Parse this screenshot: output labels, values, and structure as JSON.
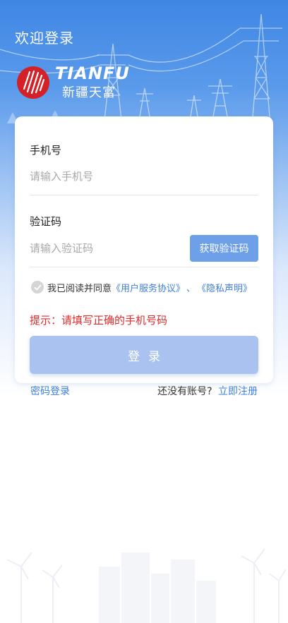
{
  "header": {
    "title": "欢迎登录",
    "logo_en": "TIANFU",
    "logo_cn": "新疆天富"
  },
  "form": {
    "phone": {
      "label": "手机号",
      "placeholder": "请输入手机号",
      "value": ""
    },
    "code": {
      "label": "验证码",
      "placeholder": "请输入验证码",
      "value": "",
      "button_label": "获取验证码"
    },
    "agreement": {
      "prefix": "我已阅读并同意",
      "user_agreement": "《用户服务协议》",
      "separator": "、",
      "privacy": "《隐私声明》",
      "checked": false
    },
    "hint": "提示：请填写正确的手机号码",
    "submit_label": "登录"
  },
  "footer": {
    "password_login": "密码登录",
    "no_account": "还没有账号?",
    "register": "立即注册"
  },
  "colors": {
    "primary": "#3d7fe0",
    "button_disabled": "#a9c2f0",
    "error": "#e22a2a",
    "logo_red": "#d42128"
  }
}
